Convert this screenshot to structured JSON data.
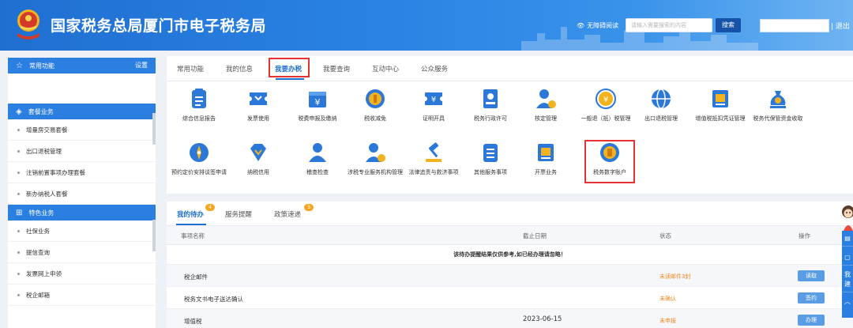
{
  "header": {
    "site_title": "国家税务总局厦门市电子税务局",
    "accessibility_label": "无障碍阅读",
    "search_placeholder": "请输入需要搜索的内容",
    "search_button": "搜索",
    "logout_label": "| 退出"
  },
  "sidebar": {
    "frequent_title": "常用功能",
    "frequent_settings": "设置",
    "package_title": "套餐业务",
    "package_items": [
      "增量房交易套餐",
      "出口退税管理",
      "注销前置事项办理套餐",
      "新办纳税人套餐"
    ],
    "special_title": "特色业务",
    "special_items": [
      "社保业务",
      "提信查询",
      "发票网上申领",
      "税企邮箱"
    ]
  },
  "tabs": [
    "常用功能",
    "我的信息",
    "我要办税",
    "我要查询",
    "互动中心",
    "公众服务"
  ],
  "active_tab": "我要办税",
  "services_row1": [
    {
      "label": "综合信息报告",
      "icon": "document-list-icon"
    },
    {
      "label": "发票使用",
      "icon": "ticket-icon"
    },
    {
      "label": "税费申报及缴纳",
      "icon": "yuan-folder-icon"
    },
    {
      "label": "税收减免",
      "icon": "coin-icon"
    },
    {
      "label": "证明开具",
      "icon": "certificate-icon"
    },
    {
      "label": "税务行政许可",
      "icon": "id-card-icon"
    },
    {
      "label": "核定管理",
      "icon": "user-gear-icon"
    },
    {
      "label": "一般退（抵）税管理",
      "icon": "refund-icon"
    },
    {
      "label": "出口退税管理",
      "icon": "globe-icon"
    },
    {
      "label": "增值税抵扣凭证管理",
      "icon": "receipt-icon"
    },
    {
      "label": "税务代保管资金收取",
      "icon": "money-bag-icon"
    }
  ],
  "services_row2": [
    {
      "label": "预约定价安排谈签申请",
      "icon": "compass-icon"
    },
    {
      "label": "纳税信用",
      "icon": "diamond-heart-icon"
    },
    {
      "label": "稽查检查",
      "icon": "user-icon"
    },
    {
      "label": "涉税专业服务机构管理",
      "icon": "user-settings-icon"
    },
    {
      "label": "法律追责与救济事项",
      "icon": "gavel-icon"
    },
    {
      "label": "其他服务事项",
      "icon": "list-icon"
    },
    {
      "label": "开票业务",
      "icon": "invoice-icon"
    },
    {
      "label": "税务数字账户",
      "icon": "digital-account-icon"
    }
  ],
  "todo": {
    "tabs": [
      "我的待办",
      "服务提醒",
      "政策速递"
    ],
    "badges": [
      "4",
      "3"
    ],
    "columns": [
      "事项名称",
      "截止日期",
      "状态",
      "操作"
    ],
    "notice": "该待办提醒结果仅供参考,如已经办理请忽略！",
    "rows": [
      {
        "name": "税企邮件",
        "deadline": "",
        "status": "未读邮件3封",
        "action": "读取"
      },
      {
        "name": "税务文书电子送达确认",
        "deadline": "",
        "status": "未确认",
        "action": "签约"
      },
      {
        "name": "增值税",
        "deadline": "2023-06-15",
        "status": "未申报",
        "action": "办理"
      }
    ]
  },
  "float": [
    "我",
    "建"
  ],
  "colors": {
    "primary": "#2a7fe0",
    "highlight_border": "#e53333",
    "status_orange": "#f08a24",
    "badge": "#f5a623"
  }
}
